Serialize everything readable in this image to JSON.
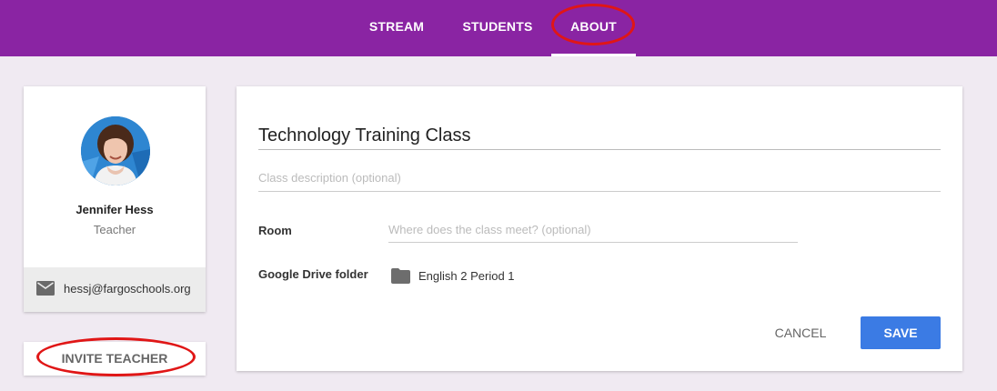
{
  "nav": {
    "tabs": [
      {
        "label": "STREAM"
      },
      {
        "label": "STUDENTS"
      },
      {
        "label": "ABOUT",
        "active": true
      }
    ]
  },
  "profile": {
    "name": "Jennifer Hess",
    "role": "Teacher",
    "email": "hessj@fargoschools.org",
    "invite_label": "INVITE TEACHER"
  },
  "form": {
    "class_name": "Technology Training Class",
    "description_placeholder": "Class description (optional)",
    "room_label": "Room",
    "room_placeholder": "Where does the class meet? (optional)",
    "drive_label": "Google Drive folder",
    "drive_folder": "English 2 Period 1",
    "cancel_label": "CANCEL",
    "save_label": "SAVE"
  },
  "colors": {
    "header": "#8a24a3",
    "accent": "#3b7be4",
    "annotation": "#e01616",
    "background": "#f0eaf2"
  },
  "icons": [
    "mail-icon",
    "folder-icon"
  ]
}
